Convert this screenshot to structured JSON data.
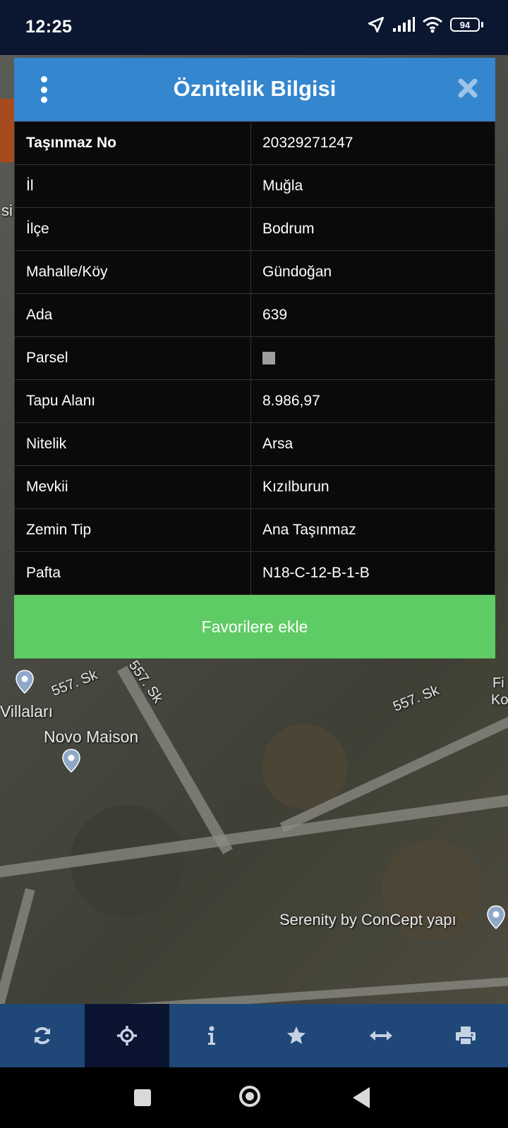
{
  "status_bar": {
    "time": "12:25",
    "battery": "94"
  },
  "map": {
    "labels": {
      "street_1": "557. Sk",
      "street_2": "557. Sk",
      "street_3": "557. Sk",
      "villalari": "Villaları",
      "novo_maison": "Novo Maison",
      "serenity": "Serenity by ConCept yapı",
      "edge_fi": "Fi",
      "edge_ko": "Ko",
      "edge_si": "si"
    }
  },
  "dialog": {
    "title": "Öznitelik Bilgisi",
    "rows": [
      {
        "label": "Taşınmaz No",
        "value": "20329271247"
      },
      {
        "label": "İl",
        "value": "Muğla"
      },
      {
        "label": "İlçe",
        "value": "Bodrum"
      },
      {
        "label": "Mahalle/Köy",
        "value": "Gündoğan"
      },
      {
        "label": "Ada",
        "value": "639"
      },
      {
        "label": "Parsel",
        "value": ""
      },
      {
        "label": "Tapu Alanı",
        "value": "8.986,97"
      },
      {
        "label": "Nitelik",
        "value": "Arsa"
      },
      {
        "label": "Mevkii",
        "value": "Kızılburun"
      },
      {
        "label": "Zemin Tip",
        "value": "Ana Taşınmaz"
      },
      {
        "label": "Pafta",
        "value": "N18-C-12-B-1-B"
      }
    ],
    "favorite_button": "Favorilere ekle"
  },
  "toolbar": {
    "items": [
      "refresh-icon",
      "crosshair-icon",
      "info-icon",
      "star-icon",
      "measure-icon",
      "print-icon"
    ],
    "active": "crosshair-icon"
  },
  "colors": {
    "header": "#3486cf",
    "favorite_button": "#5fcb64",
    "toolbar": "#1f4778",
    "toolbar_active": "#0b1430"
  }
}
